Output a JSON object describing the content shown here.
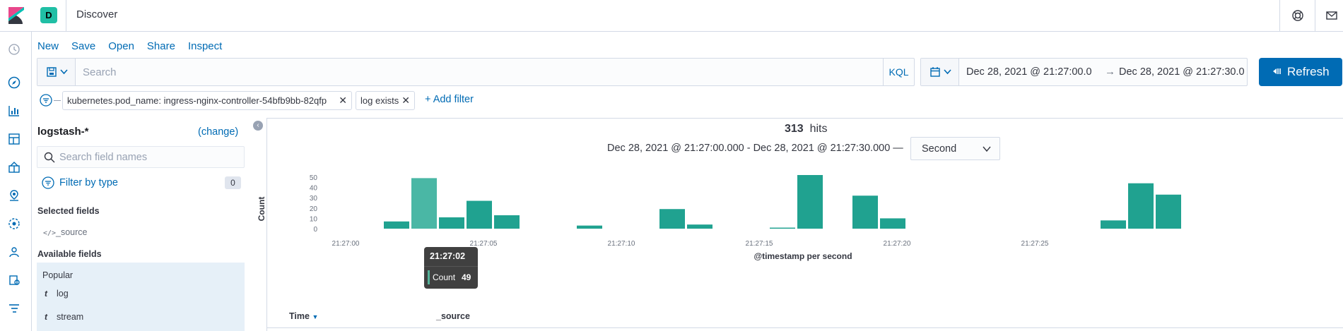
{
  "header": {
    "space_initial": "D",
    "app_title": "Discover",
    "brand_colors": {
      "logo_pink": "#e8478b",
      "logo_teal": "#00bfb3",
      "logo_dark": "#343741",
      "space": "#20bfa5"
    }
  },
  "nav_icons": [
    "recent-icon",
    "discover-icon",
    "visualize-icon",
    "dashboard-icon",
    "canvas-icon",
    "maps-icon",
    "ml-icon",
    "infrastructure-icon",
    "logs-icon",
    "apm-icon"
  ],
  "toolbar": {
    "links": [
      "New",
      "Save",
      "Open",
      "Share",
      "Inspect"
    ]
  },
  "query": {
    "placeholder": "Search",
    "language": "KQL"
  },
  "time_range": {
    "start": "Dec 28, 2021 @ 21:27:00.0",
    "arrow": "→",
    "end": "Dec 28, 2021 @ 21:27:30.0",
    "refresh_label": "Refresh"
  },
  "filters": {
    "pills": [
      "kubernetes.pod_name: ingress-nginx-controller-54bfb9bb-82qfp",
      "log exists"
    ],
    "add_label": "+ Add filter"
  },
  "sidebar": {
    "index_pattern": "logstash-*",
    "change_label": "(change)",
    "search_placeholder": "Search field names",
    "filter_by_type": "Filter by type",
    "filter_count": "0",
    "selected_title": "Selected fields",
    "selected_fields": [
      "_source"
    ],
    "available_title": "Available fields",
    "popular_title": "Popular",
    "popular_fields": [
      {
        "type": "t",
        "name": "log"
      },
      {
        "type": "t",
        "name": "stream"
      }
    ]
  },
  "histogram": {
    "hits_count": "313",
    "hits_label": "hits",
    "range_label": "Dec 28, 2021 @ 21:27:00.000 - Dec 28, 2021 @ 21:27:30.000 —",
    "interval": "Second",
    "tooltip": {
      "title": "21:27:02",
      "label": "Count",
      "value": "49"
    }
  },
  "chart_data": {
    "type": "bar",
    "xlabel": "@timestamp per second",
    "ylabel": "Count",
    "ylim": [
      0,
      52
    ],
    "yticks": [
      0,
      10,
      20,
      30,
      40,
      50
    ],
    "x_tick_labels": [
      "21:27:00",
      "21:27:05",
      "21:27:10",
      "21:27:15",
      "21:27:20",
      "21:27:25"
    ],
    "x": [
      "21:27:01",
      "21:27:02",
      "21:27:03",
      "21:27:04",
      "21:27:05",
      "21:27:08",
      "21:27:11",
      "21:27:12",
      "21:27:15",
      "21:27:16",
      "21:27:18",
      "21:27:19",
      "21:27:27",
      "21:27:28",
      "21:27:29"
    ],
    "values": [
      7,
      49,
      11,
      27,
      13,
      3,
      19,
      4,
      1,
      52,
      32,
      10,
      8,
      44,
      33
    ],
    "highlighted": "21:27:02",
    "bar_color": "#20a290",
    "highlight_color": "#4ab7a5",
    "grid": false
  },
  "table": {
    "columns": [
      "Time",
      "_source"
    ]
  }
}
